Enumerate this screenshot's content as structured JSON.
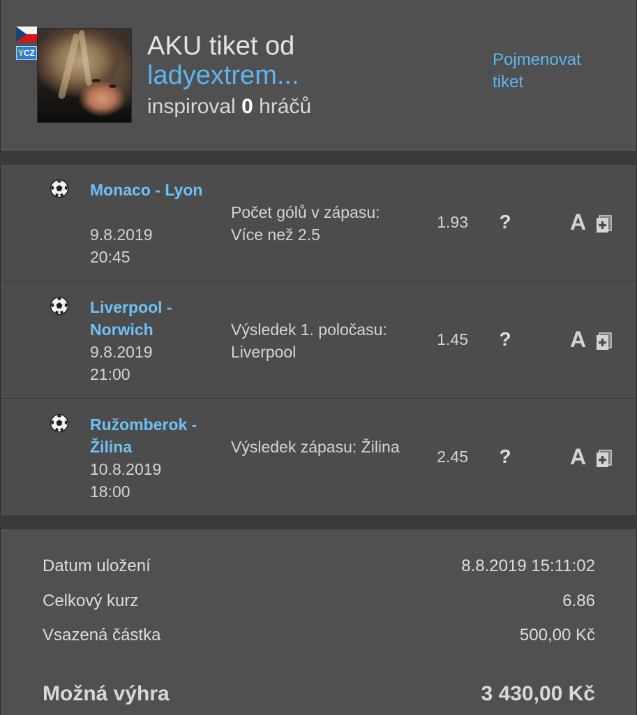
{
  "header": {
    "flag_icon": "czech-flag-icon",
    "ycz_badge": {
      "prefix": "Y",
      "suffix": "CZ"
    },
    "avatar_icon": "user-avatar",
    "title": "AKU tiket od",
    "username": "ladyextrem...",
    "inspired_prefix": "inspiroval",
    "inspired_count": "0",
    "inspired_suffix": "hráčů",
    "rename_link": "Pojmenovat tiket",
    "colors": {
      "link": "#5db6f0",
      "panel": "#505050"
    }
  },
  "bets": [
    {
      "sport_icon": "soccer-ball-icon",
      "match": "Monaco - Lyon",
      "date": "9.8.2019",
      "time": "20:45",
      "bet": "Počet gólů v zápasu: Více než 2.5",
      "odds": "1.93",
      "help": "?",
      "a_label": "A",
      "add_icon": "add-to-ticket-icon"
    },
    {
      "sport_icon": "soccer-ball-icon",
      "match": "Liverpool - Norwich",
      "date": "9.8.2019",
      "time": "21:00",
      "bet": "Výsledek 1. poločasu: Liverpool",
      "odds": "1.45",
      "help": "?",
      "a_label": "A",
      "add_icon": "add-to-ticket-icon"
    },
    {
      "sport_icon": "soccer-ball-icon",
      "match": "Ružomberok - Žilina",
      "date": "10.8.2019",
      "time": "18:00",
      "bet": "Výsledek zápasu: Žilina",
      "odds": "2.45",
      "help": "?",
      "a_label": "A",
      "add_icon": "add-to-ticket-icon"
    }
  ],
  "summary": {
    "saved_label": "Datum uložení",
    "saved_value": "8.8.2019 15:11:02",
    "total_odds_label": "Celkový kurz",
    "total_odds_value": "6.86",
    "stake_label": "Vsazená částka",
    "stake_value": "500,00 Kč",
    "win_label": "Možná výhra",
    "win_value": "3 430,00 Kč"
  }
}
